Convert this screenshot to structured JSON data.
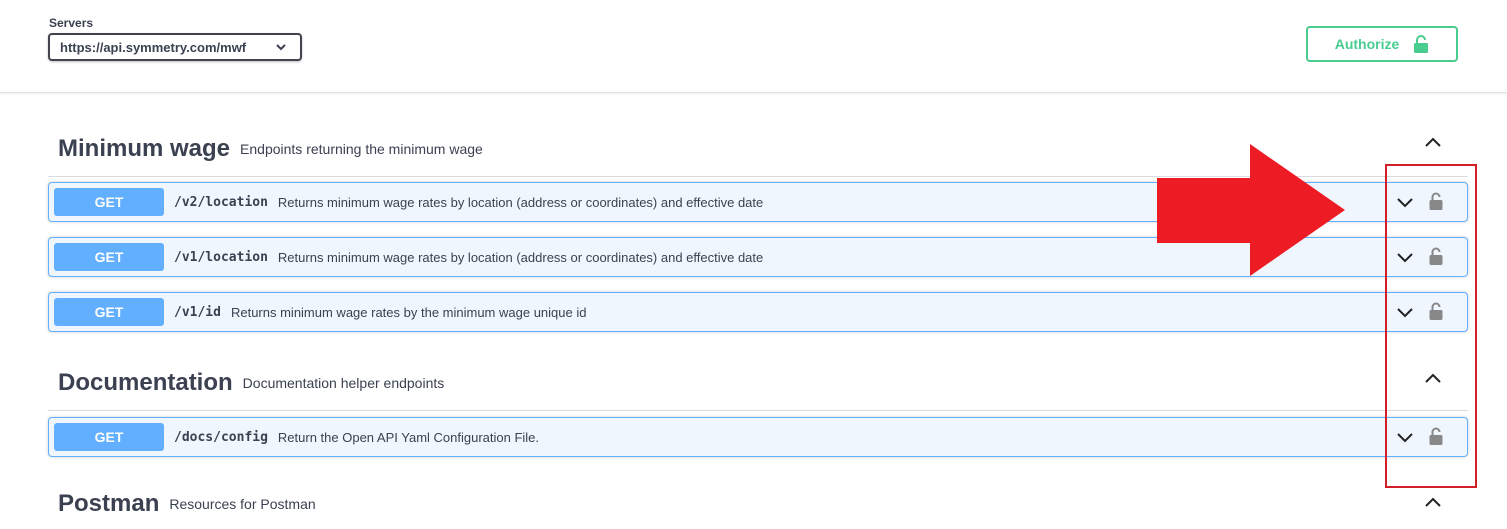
{
  "servers": {
    "label": "Servers",
    "selected": "https://api.symmetry.com/mwf"
  },
  "authorize": {
    "label": "Authorize",
    "icon": "unlocked-lock-icon",
    "color": "#49cc90"
  },
  "tags": [
    {
      "name": "Minimum wage",
      "description": "Endpoints returning the minimum wage",
      "expanded": true,
      "operations": [
        {
          "method": "GET",
          "path": "/v2/location",
          "summary": "Returns minimum wage rates by location (address or coordinates) and effective date"
        },
        {
          "method": "GET",
          "path": "/v1/location",
          "summary": "Returns minimum wage rates by location (address or coordinates) and effective date"
        },
        {
          "method": "GET",
          "path": "/v1/id",
          "summary": "Returns minimum wage rates by the minimum wage unique id"
        }
      ]
    },
    {
      "name": "Documentation",
      "description": "Documentation helper endpoints",
      "expanded": true,
      "operations": [
        {
          "method": "GET",
          "path": "/docs/config",
          "summary": "Return the Open API Yaml Configuration File."
        }
      ]
    },
    {
      "name": "Postman",
      "description": "Resources for Postman",
      "expanded": true,
      "operations": []
    }
  ],
  "colors": {
    "get_method": "#61affe",
    "get_row_bg": "#eff6fd",
    "annotation_red": "#ed1c24",
    "highlight_border": "#d11f2a"
  }
}
